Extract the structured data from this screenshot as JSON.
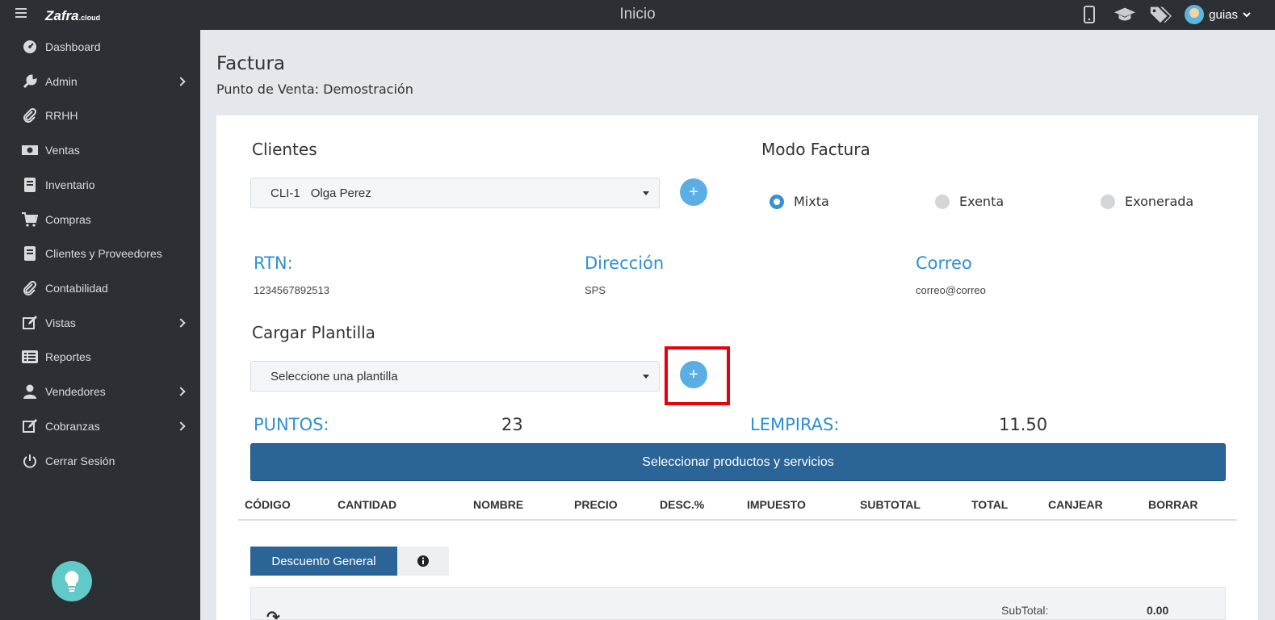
{
  "topbar": {
    "brand": "Zafra",
    "brand_suffix": ".cloud",
    "title": "Inicio",
    "user": "guias"
  },
  "sidebar": {
    "items": [
      {
        "label": "Dashboard",
        "icon": "dashboard-icon",
        "has_submenu": false
      },
      {
        "label": "Admin",
        "icon": "wrench-icon",
        "has_submenu": true
      },
      {
        "label": "RRHH",
        "icon": "paperclip-icon",
        "has_submenu": false
      },
      {
        "label": "Ventas",
        "icon": "money-icon",
        "has_submenu": false
      },
      {
        "label": "Inventario",
        "icon": "book-icon",
        "has_submenu": false
      },
      {
        "label": "Compras",
        "icon": "cart-icon",
        "has_submenu": false
      },
      {
        "label": "Clientes y Proveedores",
        "icon": "book-icon",
        "has_submenu": false
      },
      {
        "label": "Contabilidad",
        "icon": "paperclip-icon",
        "has_submenu": false
      },
      {
        "label": "Vistas",
        "icon": "edit-icon",
        "has_submenu": true
      },
      {
        "label": "Reportes",
        "icon": "list-icon",
        "has_submenu": false
      },
      {
        "label": "Vendedores",
        "icon": "user-icon",
        "has_submenu": true
      },
      {
        "label": "Cobranzas",
        "icon": "edit-icon",
        "has_submenu": true
      },
      {
        "label": "Cerrar Sesión",
        "icon": "power-icon",
        "has_submenu": false
      }
    ]
  },
  "page": {
    "title": "Factura",
    "subtitle": "Punto de Venta: Demostración"
  },
  "clientes": {
    "title": "Clientes",
    "selected_code": "CLI-1",
    "selected_name": "Olga Perez",
    "add_label": "+"
  },
  "modo": {
    "title": "Modo Factura",
    "options": [
      "Mixta",
      "Exenta",
      "Exonerada"
    ],
    "selected": "Mixta"
  },
  "info": {
    "rtn_label": "RTN:",
    "rtn_value": "1234567892513",
    "direccion_label": "Dirección",
    "direccion_value": "SPS",
    "correo_label": "Correo",
    "correo_value": "correo@correo"
  },
  "plantilla": {
    "title": "Cargar Plantilla",
    "placeholder": "Seleccione una plantilla",
    "add_label": "+"
  },
  "puntos": {
    "puntos_label": "PUNTOS:",
    "puntos_value": "23",
    "lempiras_label": "LEMPIRAS:",
    "lempiras_value": "11.50"
  },
  "select_products_label": "Seleccionar productos y servicios",
  "table": {
    "columns": [
      "CÓDIGO",
      "CANTIDAD",
      "NOMBRE",
      "PRECIO",
      "DESC.%",
      "IMPUESTO",
      "SUBTOTAL",
      "TOTAL",
      "CANJEAR",
      "BORRAR"
    ]
  },
  "discount": {
    "label": "Descuento General"
  },
  "totals": {
    "subtotal_label": "SubTotal:",
    "subtotal_value": "0.00"
  },
  "colors": {
    "sidebar_bg": "#2c3034",
    "accent_blue": "#2f8fd3",
    "primary_button": "#2b6496",
    "plus_button": "#5aaee3",
    "highlight": "#e8000b"
  }
}
